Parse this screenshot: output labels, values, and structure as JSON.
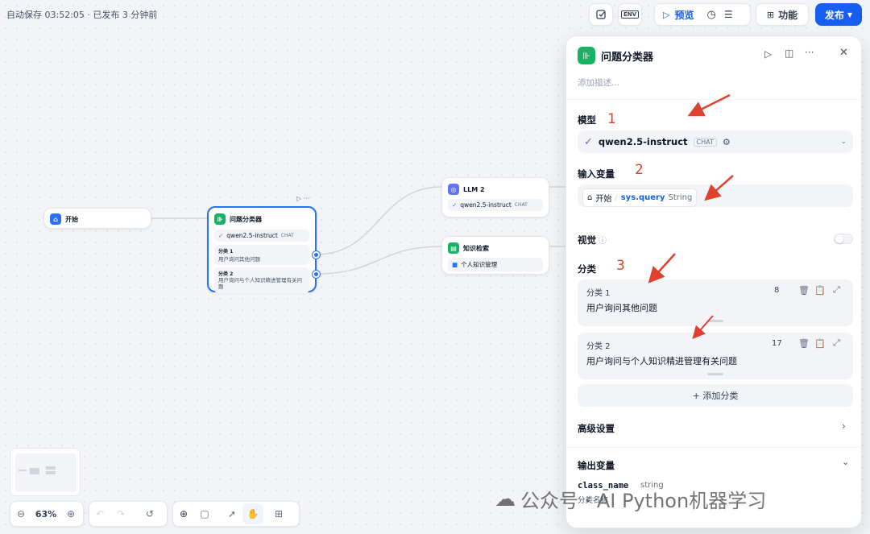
{
  "topbar": {
    "autosave": "自动保存 03:52:05 · 已发布 3 分钟前",
    "env_label": "ENV",
    "preview_label": "预览",
    "features_label": "功能",
    "publish_label": "发布"
  },
  "canvas": {
    "start_node": {
      "title": "开始"
    },
    "classifier_node": {
      "title": "问题分类器",
      "model": "qwen2.5-instruct",
      "model_badge": "CHAT",
      "classes": [
        {
          "label": "分类 1",
          "text": "用户询问其他问题"
        },
        {
          "label": "分类 2",
          "text": "用户询问与个人知识精进管理有关问题"
        }
      ]
    },
    "llm_node": {
      "title": "LLM 2",
      "model": "qwen2.5-instruct",
      "model_badge": "CHAT"
    },
    "kb_node": {
      "title": "知识检索",
      "dataset": "个人知识管理"
    }
  },
  "zoom": {
    "level": "63%"
  },
  "panel": {
    "title": "问题分类器",
    "description_placeholder": "添加描述...",
    "model_section": {
      "label": "模型",
      "model_name": "qwen2.5-instruct",
      "model_badge": "CHAT"
    },
    "input_section": {
      "label": "输入变量",
      "source": "开始",
      "separator": "/",
      "variable": "sys.query",
      "type": "String"
    },
    "vision_section": {
      "label": "视觉",
      "enabled": false
    },
    "class_section": {
      "label": "分类",
      "items": [
        {
          "label": "分类 1",
          "count": "8",
          "text": "用户询问其他问题"
        },
        {
          "label": "分类 2",
          "count": "17",
          "text": "用户询问与个人知识精进管理有关问题"
        }
      ],
      "add_label": "+ 添加分类"
    },
    "advanced_label": "高级设置",
    "output_section": {
      "label": "输出变量",
      "var_name": "class_name",
      "var_type": "string",
      "var_desc": "分类名称"
    }
  },
  "annotations": {
    "n1": "1",
    "n2": "2",
    "n3": "3"
  },
  "watermark": "公众号 · AI Python机器学习",
  "colors": {
    "accent": "#155eef",
    "node_green": "#16b364",
    "kb_blue": "#2970ff",
    "arrow_red": "#e0402e"
  }
}
